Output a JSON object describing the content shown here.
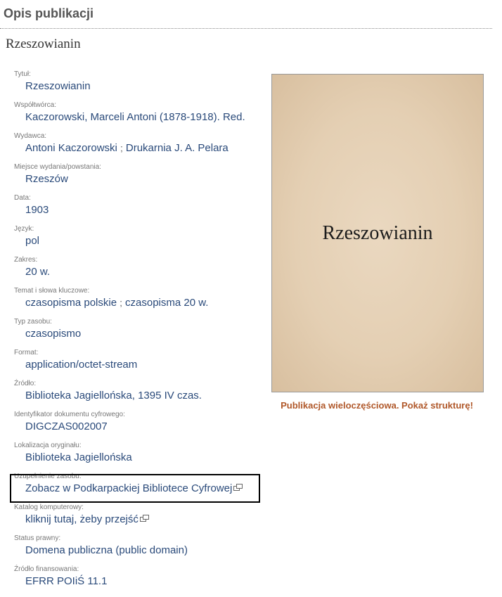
{
  "header": {
    "title": "Opis publikacji"
  },
  "publication": {
    "title": "Rzeszowianin",
    "cover_title": "Rzeszowianin",
    "multipart_notice": "Publikacja wieloczęściowa. Pokaż strukturę!"
  },
  "fields": [
    {
      "label": "Tytuł:",
      "value": "Rzeszowianin"
    },
    {
      "label": "Współtwórca:",
      "value": "Kaczorowski, Marceli Antoni (1878-1918). Red."
    },
    {
      "label": "Wydawca:",
      "value_parts": [
        "Antoni Kaczorowski",
        "Drukarnia J. A. Pelara"
      ]
    },
    {
      "label": "Miejsce wydania/powstania:",
      "value": "Rzeszów"
    },
    {
      "label": "Data:",
      "value": "1903"
    },
    {
      "label": "Język:",
      "value": "pol"
    },
    {
      "label": "Zakres:",
      "value": "20 w."
    },
    {
      "label": "Temat i słowa kluczowe:",
      "value_parts": [
        "czasopisma polskie",
        "czasopisma 20 w."
      ]
    },
    {
      "label": "Typ zasobu:",
      "value": "czasopismo"
    },
    {
      "label": "Format:",
      "value": "application/octet-stream"
    },
    {
      "label": "Źródło:",
      "value": "Biblioteka Jagiellońska, 1395 IV czas."
    },
    {
      "label": "Identyfikator dokumentu cyfrowego:",
      "value": "DIGCZAS002007"
    },
    {
      "label": "Lokalizacja oryginału:",
      "value": "Biblioteka Jagiellońska"
    },
    {
      "label": "Uzupełnienie zasobu:",
      "value": "Zobacz w Podkarpackiej Bibliotece Cyfrowej",
      "link": true
    },
    {
      "label": "Katalog komputerowy:",
      "value": "kliknij tutaj, żeby przejść",
      "link": true
    },
    {
      "label": "Status prawny:",
      "value": "Domena publiczna (public domain)"
    },
    {
      "label": "Źródło finansowania:",
      "value": "EFRR POIiŚ 11.1"
    }
  ],
  "separator": ";",
  "colors": {
    "label": "#777777",
    "value": "#2a4a7a",
    "notice": "#b0582a",
    "cover": "#e4cfb3"
  },
  "icons": {
    "external_link": "external-link-icon"
  }
}
